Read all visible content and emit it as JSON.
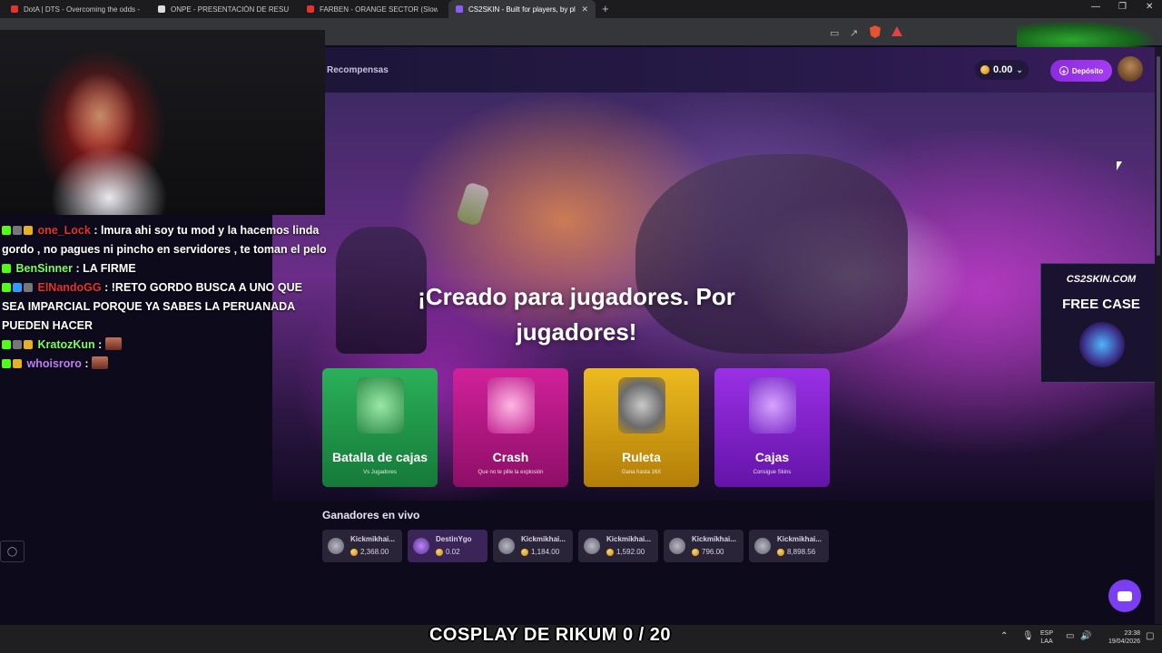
{
  "browser": {
    "tabs": [
      {
        "title": "DotA | DTS - Overcoming the odds -",
        "favicon_color": "#e5322d"
      },
      {
        "title": "ONPE - PRESENTACIÓN DE RESULTAD",
        "favicon_color": "#dddddd"
      },
      {
        "title": "FARBEN - ORANGE SECTOR (Slow",
        "favicon_color": "#e5322d"
      },
      {
        "title": "CS2SKIN - Built for players, by pl",
        "favicon_color": "#8b5cf6"
      }
    ],
    "new_tab_icon": "plus-icon",
    "window_controls": [
      "minimize-icon",
      "restore-icon",
      "close-icon"
    ]
  },
  "site": {
    "nav": {
      "rewards": "Recompensas"
    },
    "balance": "0.00",
    "deposit_label": "Depósito",
    "hero_title": "¡Creado para jugadores. Por jugadores!",
    "modes": [
      {
        "title": "Batalla de cajas",
        "subtitle": "Vs Jugadores",
        "color": "#1f9d4a"
      },
      {
        "title": "Crash",
        "subtitle": "Que no te pille la explosión",
        "color": "#c0188a"
      },
      {
        "title": "Ruleta",
        "subtitle": "Gana hasta 16X",
        "color": "#d9a515"
      },
      {
        "title": "Cajas",
        "subtitle": "Consigue Skins",
        "color": "#8a22d6"
      }
    ],
    "winners_title": "Ganadores en vivo",
    "winners": [
      {
        "name": "Kickmikhai...",
        "amount": "2,368.00"
      },
      {
        "name": "DestinYgo",
        "amount": "0.02"
      },
      {
        "name": "Kickmikhai...",
        "amount": "1,184.00"
      },
      {
        "name": "Kickmikhai...",
        "amount": "1,592.00"
      },
      {
        "name": "Kickmikhai...",
        "amount": "796.00"
      },
      {
        "name": "Kickmikhai...",
        "amount": "8,898.56"
      }
    ],
    "promo": {
      "site": "CS2SKIN.COM",
      "headline": "FREE CASE"
    }
  },
  "stream_chat": [
    {
      "user": "one_Lock",
      "user_color": "#e5322d",
      "text": ": lmura ahi soy tu mod y la hacemos linda gordo , no pagues ni pincho en servidores , te toman el pelo"
    },
    {
      "user": "BenSinner",
      "user_color": "#7cff5a",
      "text": ": LA FIRME"
    },
    {
      "user": "ElNandoGG",
      "user_color": "#e5322d",
      "text": ": !RETO GORDO BUSCA A UNO QUE SEA IMPARCIAL PORQUE YA SABES LA PERUANADA PUEDEN HACER"
    },
    {
      "user": "KratozKun",
      "user_color": "#7cff5a",
      "text": ":"
    },
    {
      "user": "whoisroro",
      "user_color": "#c17dff",
      "text": ":"
    }
  ],
  "overlay": {
    "title": "COSPLAY DE RIKUM 0 / 20"
  },
  "taskbar": {
    "lang_top": "ESP",
    "lang_bottom": "LAA",
    "time": "23:38",
    "date": "19/04/2026"
  }
}
